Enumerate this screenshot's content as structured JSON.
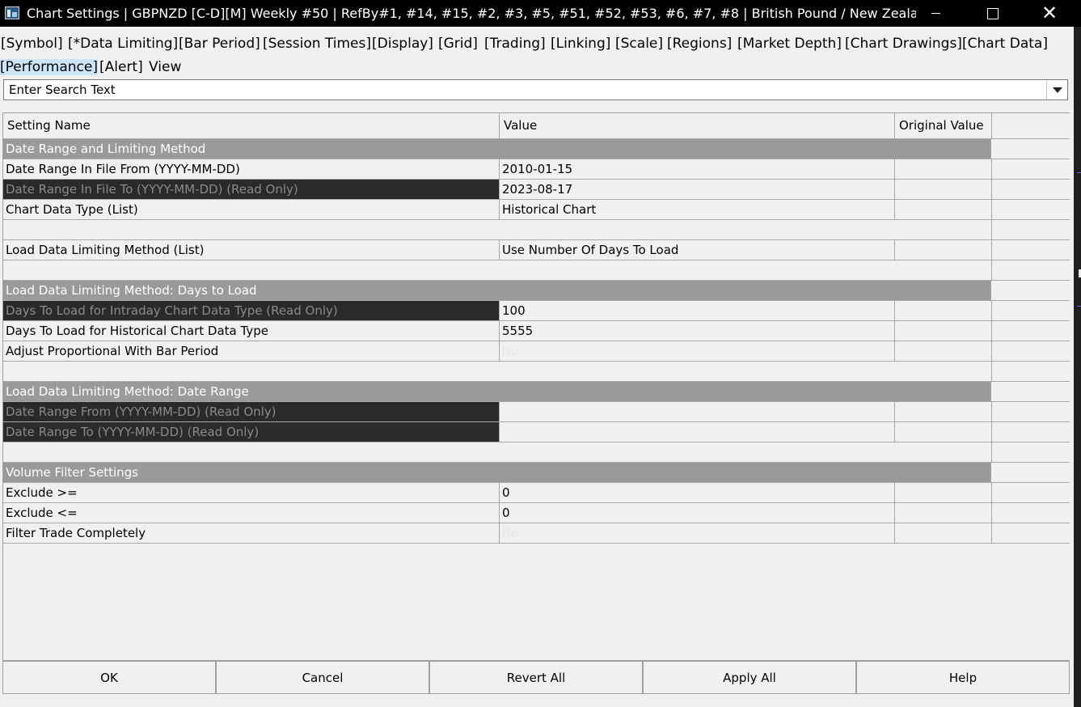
{
  "window": {
    "title": "Chart Settings | GBPNZD [C-D][M]  Weekly  #50 | RefBy#1, #14, #15, #2, #3, #5, #51, #52, #53, #6, #7, #8 | British Pound / New Zealand ..."
  },
  "menu": [
    "[Symbol]",
    "[*Data Limiting]",
    "[Bar Period]",
    "[Session Times]",
    "[Display]",
    "[Grid]",
    "[Trading]",
    "[Linking]",
    "[Scale]",
    "[Regions]",
    "[Market Depth]",
    "[Chart Drawings]",
    "[Chart Data]",
    "[Performance]",
    "[Alert]",
    "View"
  ],
  "search": {
    "placeholder": "Enter Search Text"
  },
  "table": {
    "headers": [
      "Setting Name",
      "Value",
      "Original Value",
      ""
    ],
    "rows": [
      {
        "type": "section",
        "name": "Date Range and Limiting Method"
      },
      {
        "type": "row",
        "name": "Date Range In File From (YYYY-MM-DD)",
        "value": "2010-01-15",
        "original": ""
      },
      {
        "type": "readonly",
        "name": "Date Range In File To (YYYY-MM-DD) (Read Only)",
        "value": "2023-08-17",
        "original": ""
      },
      {
        "type": "row",
        "name": "Chart Data Type (List)",
        "value": "Historical Chart",
        "original": ""
      },
      {
        "type": "blank"
      },
      {
        "type": "row",
        "name": "Load Data Limiting Method (List)",
        "value": "Use Number Of Days To Load",
        "original": ""
      },
      {
        "type": "blank"
      },
      {
        "type": "section",
        "name": "Load Data Limiting Method: Days to Load"
      },
      {
        "type": "readonly",
        "name": "Days To Load for Intraday Chart Data Type (Read Only)",
        "value": "100",
        "original": ""
      },
      {
        "type": "row",
        "name": "Days To Load for Historical Chart Data Type",
        "value": "5555",
        "original": ""
      },
      {
        "type": "row",
        "name": "Adjust Proportional With Bar Period",
        "value": "No",
        "faint": true,
        "original": ""
      },
      {
        "type": "blank"
      },
      {
        "type": "section",
        "name": "Load Data Limiting Method: Date Range"
      },
      {
        "type": "readonly",
        "name": "Date Range From (YYYY-MM-DD) (Read Only)",
        "value": "",
        "original": ""
      },
      {
        "type": "readonly",
        "name": "Date Range To (YYYY-MM-DD) (Read Only)",
        "value": "",
        "original": ""
      },
      {
        "type": "blank"
      },
      {
        "type": "section",
        "name": "Volume Filter Settings"
      },
      {
        "type": "row",
        "name": "Exclude >=",
        "value": "0",
        "original": ""
      },
      {
        "type": "row",
        "name": "Exclude <=",
        "value": "0",
        "original": ""
      },
      {
        "type": "row",
        "name": "Filter Trade Completely",
        "value": "No",
        "faint": true,
        "original": ""
      }
    ]
  },
  "buttons": {
    "ok": "OK",
    "cancel": "Cancel",
    "revert_all": "Revert All",
    "apply_all": "Apply All",
    "help": "Help"
  },
  "colors": {
    "titlebar": "#000000",
    "section": "#9a9a9a",
    "readonly": "#2a2a2a",
    "selected_tab": "#cce4f7"
  }
}
